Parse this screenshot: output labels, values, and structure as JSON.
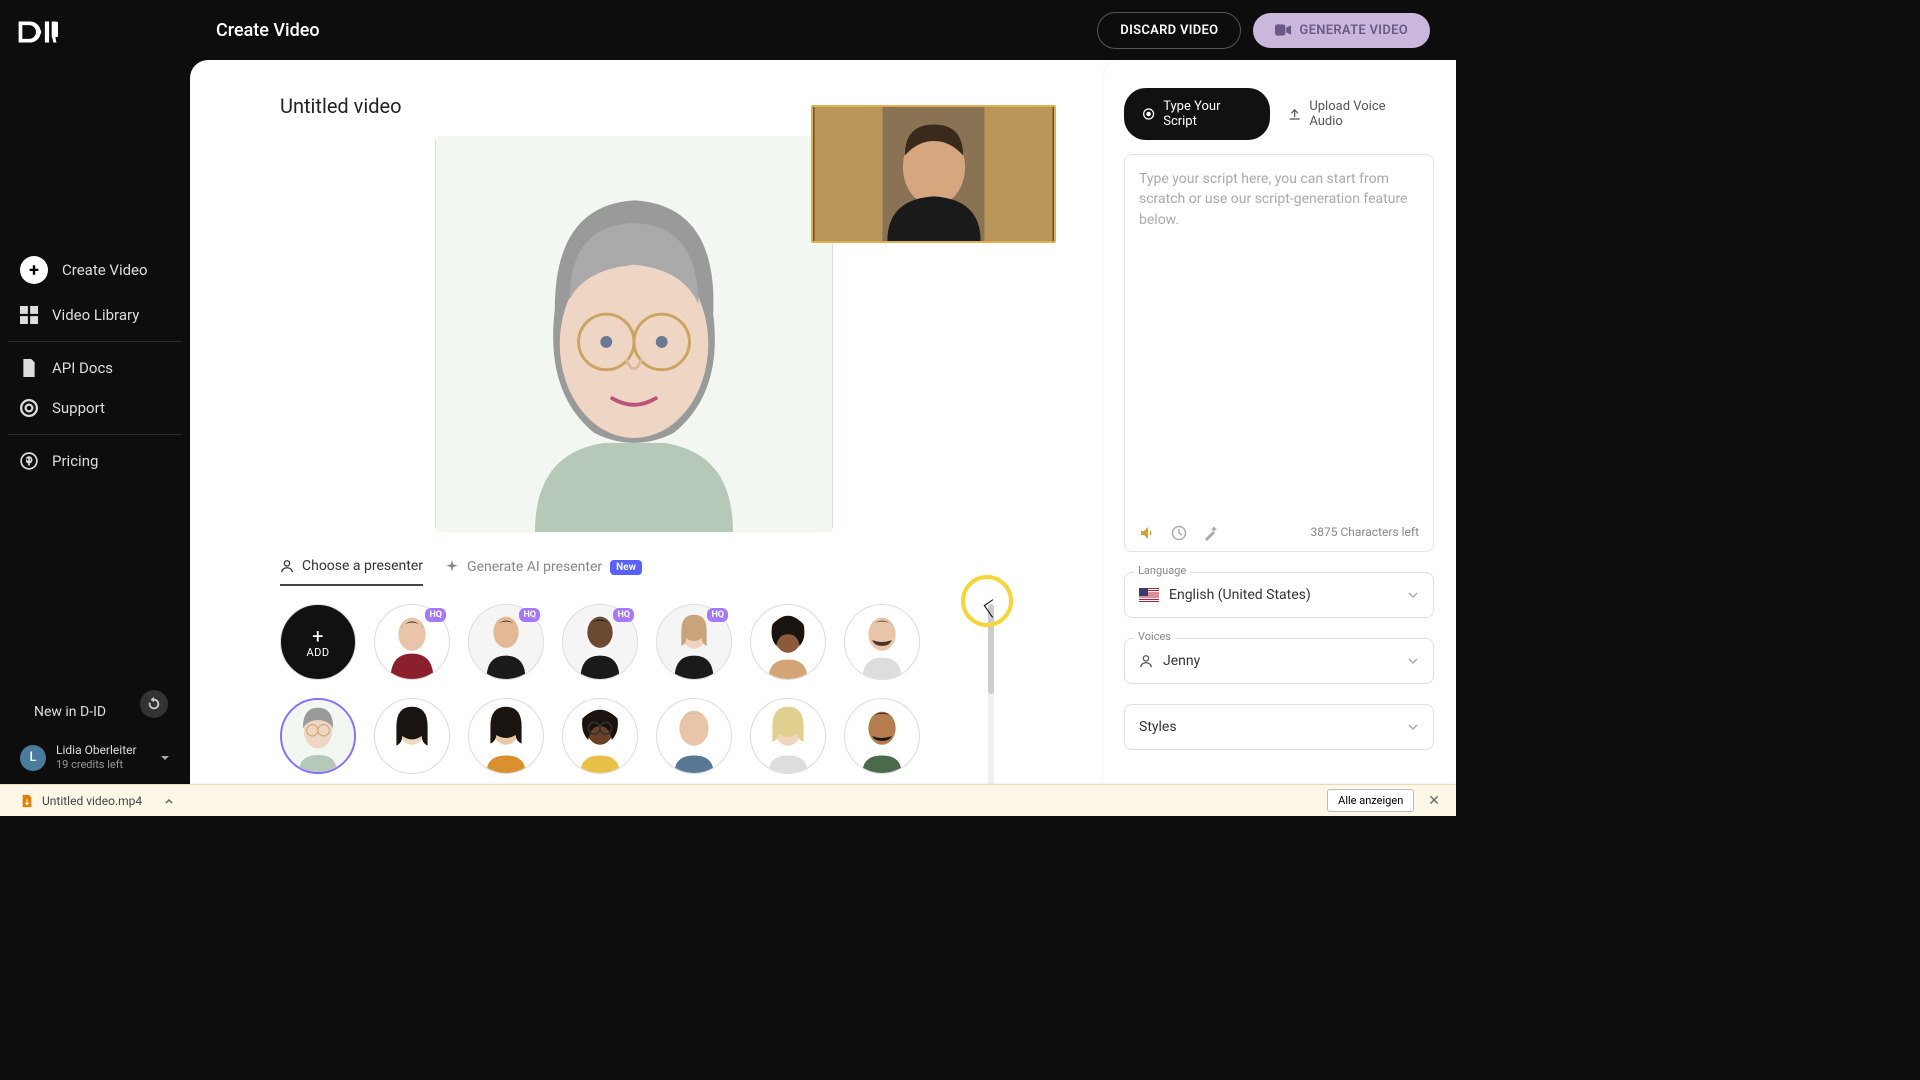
{
  "header": {
    "page_title": "Create Video",
    "discard_label": "DISCARD VIDEO",
    "generate_label": "GENERATE VIDEO"
  },
  "sidebar": {
    "items": [
      {
        "label": "Create Video",
        "icon": "plus"
      },
      {
        "label": "Video Library",
        "icon": "grid"
      },
      {
        "label": "API Docs",
        "icon": "doc"
      },
      {
        "label": "Support",
        "icon": "life-ring"
      },
      {
        "label": "Pricing",
        "icon": "dollar"
      }
    ],
    "new_in_label": "New in D-ID",
    "user": {
      "initial": "L",
      "name": "Lidia Oberleiter",
      "credits": "19 credits left"
    }
  },
  "editor": {
    "video_title": "Untitled video",
    "tabs": {
      "choose": "Choose a presenter",
      "generate": "Generate AI presenter",
      "new_badge": "New"
    },
    "add_label": "ADD",
    "hq_label": "HQ"
  },
  "script_panel": {
    "tab_type": "Type Your Script",
    "tab_upload": "Upload Voice Audio",
    "placeholder": "Type your script here, you can start from scratch or use our script-generation feature below.",
    "char_count": "3875 Characters left",
    "language_label": "Language",
    "language_value": "English (United States)",
    "voices_label": "Voices",
    "voices_value": "Jenny",
    "styles_label": "Styles"
  },
  "download_bar": {
    "filename": "Untitled video.mp4",
    "show_all": "Alle anzeigen"
  }
}
